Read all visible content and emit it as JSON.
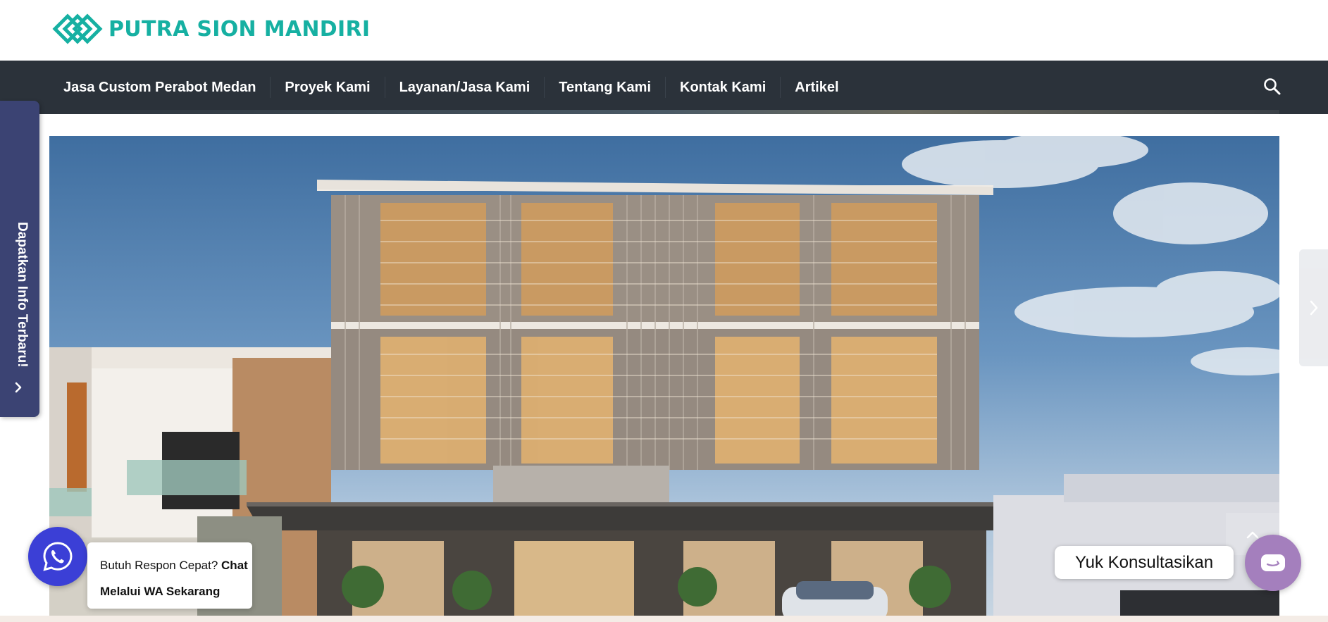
{
  "brand": {
    "name": "PUTRA SION MANDIRI",
    "color": "#16b0a2"
  },
  "nav": {
    "items": [
      {
        "label": "Jasa Custom Perabot Medan"
      },
      {
        "label": "Proyek Kami"
      },
      {
        "label": "Layanan/Jasa Kami"
      },
      {
        "label": "Tentang Kami"
      },
      {
        "label": "Kontak Kami"
      },
      {
        "label": "Artikel"
      }
    ],
    "search_icon": "search-icon",
    "background": "#2b323a"
  },
  "side_tab": {
    "label": "Dapatkan Info Terbaru!",
    "icon": "chevron-right-icon",
    "color": "#3b4373"
  },
  "hero": {
    "image": "building-render",
    "next_icon": "chevron-right-icon"
  },
  "whatsapp": {
    "icon": "whatsapp-icon",
    "text_plain": "Butuh Respon Cepat?",
    "text_bold_1": "Chat",
    "text_bold_2": "Melalui WA Sekarang",
    "color": "#3b3fd6"
  },
  "consult": {
    "label": "Yuk Konsultasikan",
    "icon": "chat-icon",
    "color": "#a47fbd",
    "scroll_icon": "chevron-up-icon"
  }
}
